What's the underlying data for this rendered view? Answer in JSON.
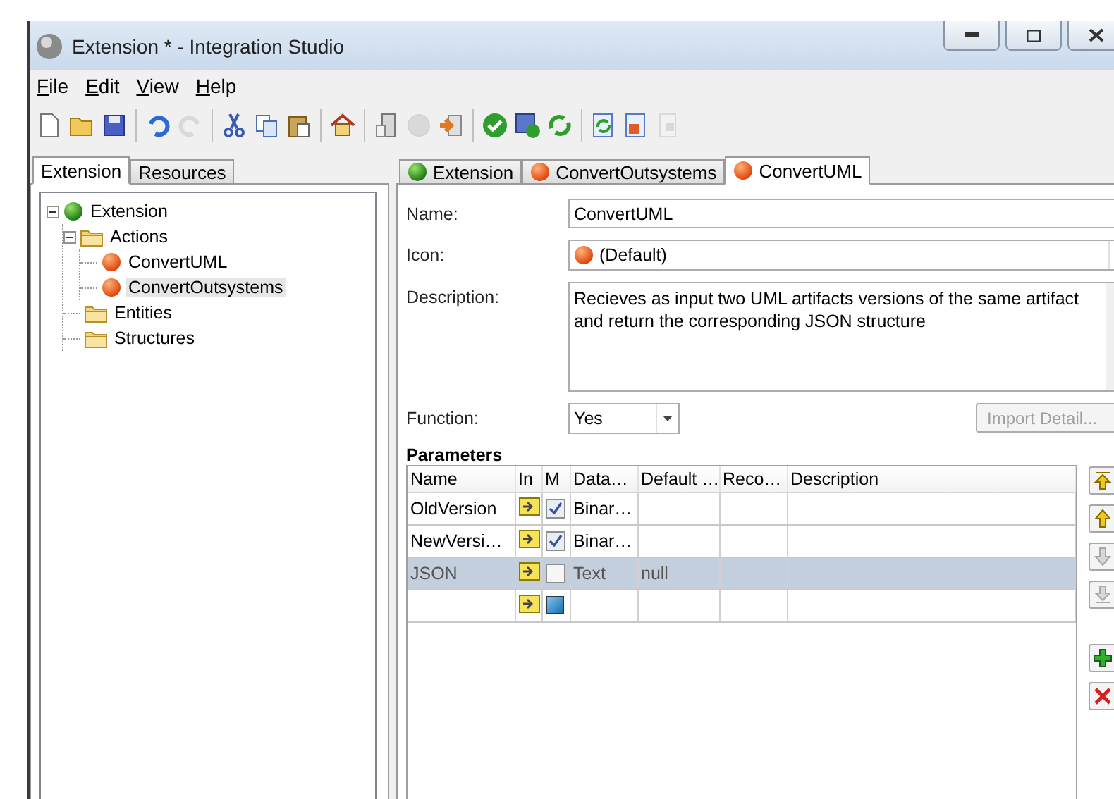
{
  "window": {
    "title": "Extension * - Integration Studio"
  },
  "menu": [
    "File",
    "Edit",
    "View",
    "Help"
  ],
  "toolbar": [
    {
      "kind": "new",
      "disabled": false
    },
    {
      "kind": "open",
      "disabled": false
    },
    {
      "kind": "save",
      "disabled": false
    },
    {
      "kind": "separator"
    },
    {
      "kind": "undo",
      "disabled": false
    },
    {
      "kind": "redo",
      "disabled": true
    },
    {
      "kind": "separator"
    },
    {
      "kind": "cut",
      "disabled": false
    },
    {
      "kind": "copy",
      "disabled": false
    },
    {
      "kind": "paste",
      "disabled": false
    },
    {
      "kind": "separator"
    },
    {
      "kind": "home",
      "disabled": false
    },
    {
      "kind": "separator"
    },
    {
      "kind": "server",
      "disabled": false
    },
    {
      "kind": "disc",
      "disabled": true
    },
    {
      "kind": "import",
      "disabled": false
    },
    {
      "kind": "separator"
    },
    {
      "kind": "verify",
      "disabled": false
    },
    {
      "kind": "publish",
      "disabled": false
    },
    {
      "kind": "sync",
      "disabled": false
    },
    {
      "kind": "separator"
    },
    {
      "kind": "refresh",
      "disabled": false
    },
    {
      "kind": "code",
      "disabled": false
    },
    {
      "kind": "device",
      "disabled": true
    }
  ],
  "left_tabs": [
    {
      "label": "Extension",
      "selected": true
    },
    {
      "label": "Resources",
      "selected": false
    }
  ],
  "tree": [
    {
      "label": "Extension",
      "kind": "extension",
      "expanded": true,
      "selected": false,
      "children": [
        {
          "label": "Actions",
          "kind": "folder",
          "expanded": true,
          "selected": false,
          "children": [
            {
              "label": "ConvertUML",
              "kind": "action",
              "selected": false
            },
            {
              "label": "ConvertOutsystems",
              "kind": "action",
              "selected": true
            }
          ]
        },
        {
          "label": "Entities",
          "kind": "folder",
          "selected": false
        },
        {
          "label": "Structures",
          "kind": "folder",
          "selected": false
        }
      ]
    }
  ],
  "editor_tabs": [
    {
      "label": "Extension",
      "kind": "extension",
      "selected": false
    },
    {
      "label": "ConvertOutsystems",
      "kind": "action",
      "selected": false
    },
    {
      "label": "ConvertUML",
      "kind": "action",
      "selected": true
    }
  ],
  "form": {
    "name_label": "Name:",
    "name": "ConvertUML",
    "icon_label": "Icon:",
    "icon": "(Default)",
    "description_label": "Description:",
    "description": "Recieves as input two UML artifacts versions of the same artifact and return the corresponding JSON structure",
    "function_label": "Function:",
    "function": "Yes",
    "import_button": {
      "label": "Import Detail...",
      "disabled": true
    }
  },
  "parameters": {
    "title": "Parameters",
    "columns": [
      "Name",
      "In",
      "M",
      "Data…",
      "Default …",
      "Reco…",
      "Description"
    ],
    "rows": [
      {
        "kind": "param",
        "name": "OldVersion",
        "mandatory": true,
        "data_type": "Binar…",
        "default": "",
        "selected": false
      },
      {
        "kind": "param",
        "name": "NewVersi…",
        "mandatory": true,
        "data_type": "Binar…",
        "default": "",
        "selected": false
      },
      {
        "kind": "param",
        "name": "JSON",
        "mandatory": false,
        "data_type": "Text",
        "default": "null",
        "selected": true
      },
      {
        "kind": "new",
        "selected": false
      }
    ],
    "buttons": [
      {
        "kind": "top",
        "disabled": false
      },
      {
        "kind": "up",
        "disabled": false
      },
      {
        "kind": "down",
        "disabled": true
      },
      {
        "kind": "bottom",
        "disabled": true
      },
      {
        "kind": "add",
        "disabled": false
      },
      {
        "kind": "delete",
        "disabled": false
      }
    ]
  }
}
